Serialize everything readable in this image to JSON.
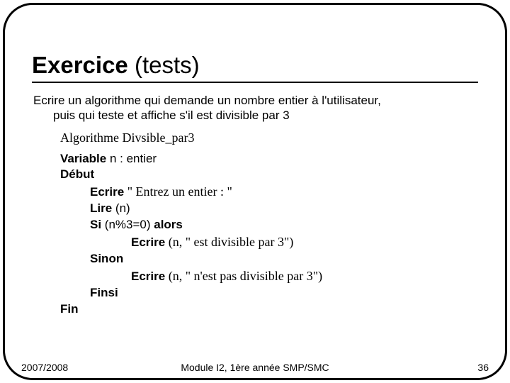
{
  "title": {
    "main": "Exercice",
    "sub": " (tests)"
  },
  "prompt": {
    "line1": "Ecrire un algorithme qui demande un nombre entier à l'utilisateur,",
    "line2": "puis qui teste et affiche s'il est divisible par 3"
  },
  "algo": {
    "name": "Algorithme Divsible_par3",
    "var_kw": "Variable",
    "var_rest": " n : entier",
    "debut": "Début",
    "ecrire1_kw": "Ecrire",
    "ecrire1_rest": " \" Entrez un entier : \"",
    "lire_kw": "Lire",
    "lire_rest": " (n)",
    "si_kw": "Si",
    "si_cond": " (n%3=0) ",
    "alors_kw": "alors",
    "ecrire2_kw": "Ecrire",
    "ecrire2_rest": " (n, \" est divisible par 3\")",
    "sinon": "Sinon",
    "ecrire3_kw": "Ecrire",
    "ecrire3_rest": " (n, \" n'est pas divisible par 3\")",
    "finsi": "Finsi",
    "fin": "Fin"
  },
  "footer": {
    "left": "2007/2008",
    "center": "Module I2, 1ère année SMP/SMC",
    "right": "36"
  }
}
